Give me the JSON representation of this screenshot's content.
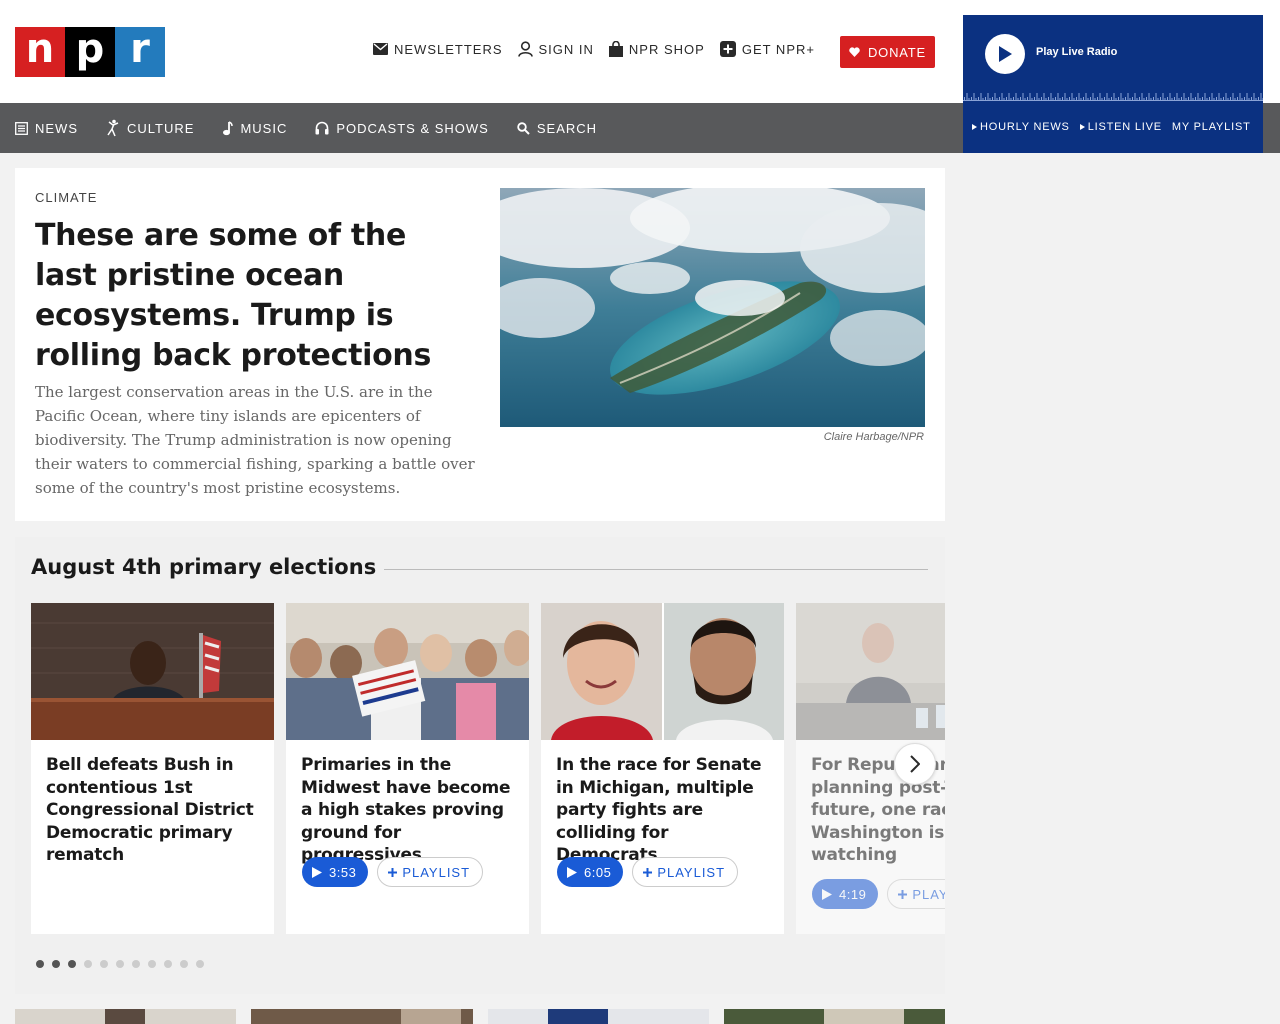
{
  "colors": {
    "brand_red": "#d62021",
    "brand_blue": "#237bbd",
    "nav_gray": "#58595b",
    "player_blue": "#0b3181",
    "accent_blue": "#1a5bd6"
  },
  "logo": {
    "n": "n",
    "p": "p",
    "r": "r"
  },
  "utility": [
    {
      "label": "NEWSLETTERS",
      "icon": "envelope-icon"
    },
    {
      "label": "SIGN IN",
      "icon": "user-icon"
    },
    {
      "label": "NPR SHOP",
      "icon": "shopping-bag-icon"
    },
    {
      "label": "GET NPR+",
      "icon": "plus-square-icon"
    }
  ],
  "donate": {
    "label": "DONATE",
    "icon": "heart-icon"
  },
  "nav": [
    {
      "label": "NEWS",
      "icon": "news-icon"
    },
    {
      "label": "CULTURE",
      "icon": "culture-icon"
    },
    {
      "label": "MUSIC",
      "icon": "music-note-icon"
    },
    {
      "label": "PODCASTS & SHOWS",
      "icon": "headphones-icon"
    },
    {
      "label": "SEARCH",
      "icon": "search-icon"
    }
  ],
  "player": {
    "play_label": "Play Live Radio",
    "links": [
      "HOURLY NEWS",
      "LISTEN LIVE",
      "MY PLAYLIST"
    ]
  },
  "hero": {
    "slug": "CLIMATE",
    "title": "These are some of the last pristine ocean ecosystems. Trump is rolling back protections",
    "teaser": "The largest conservation areas in the U.S. are in the Pacific Ocean, where tiny islands are epicenters of biodiversity. The Trump administration is now opening their waters to commercial fishing, sparking a battle over some of the country's most pristine ecosystems.",
    "credit": "Claire Harbage/NPR"
  },
  "elections": {
    "heading": "August 4th primary elections",
    "cards": [
      {
        "title": "Bell defeats Bush in contentious 1st Congressional District Democratic primary rematch"
      },
      {
        "title": "Primaries in the Midwest have become a high stakes proving ground for progressives",
        "duration": "3:53",
        "playlist": "PLAYLIST"
      },
      {
        "title": "In the race for Senate in Michigan, multiple party fights are colliding for Democrats",
        "duration": "6:05",
        "playlist": "PLAYLIST"
      },
      {
        "title": "For Republicans planning post-Trump future, one race Washington is watching",
        "duration": "4:19",
        "playlist": "PLAYLIST"
      }
    ],
    "dots_total": 11,
    "dots_active": [
      0,
      1,
      2
    ]
  }
}
